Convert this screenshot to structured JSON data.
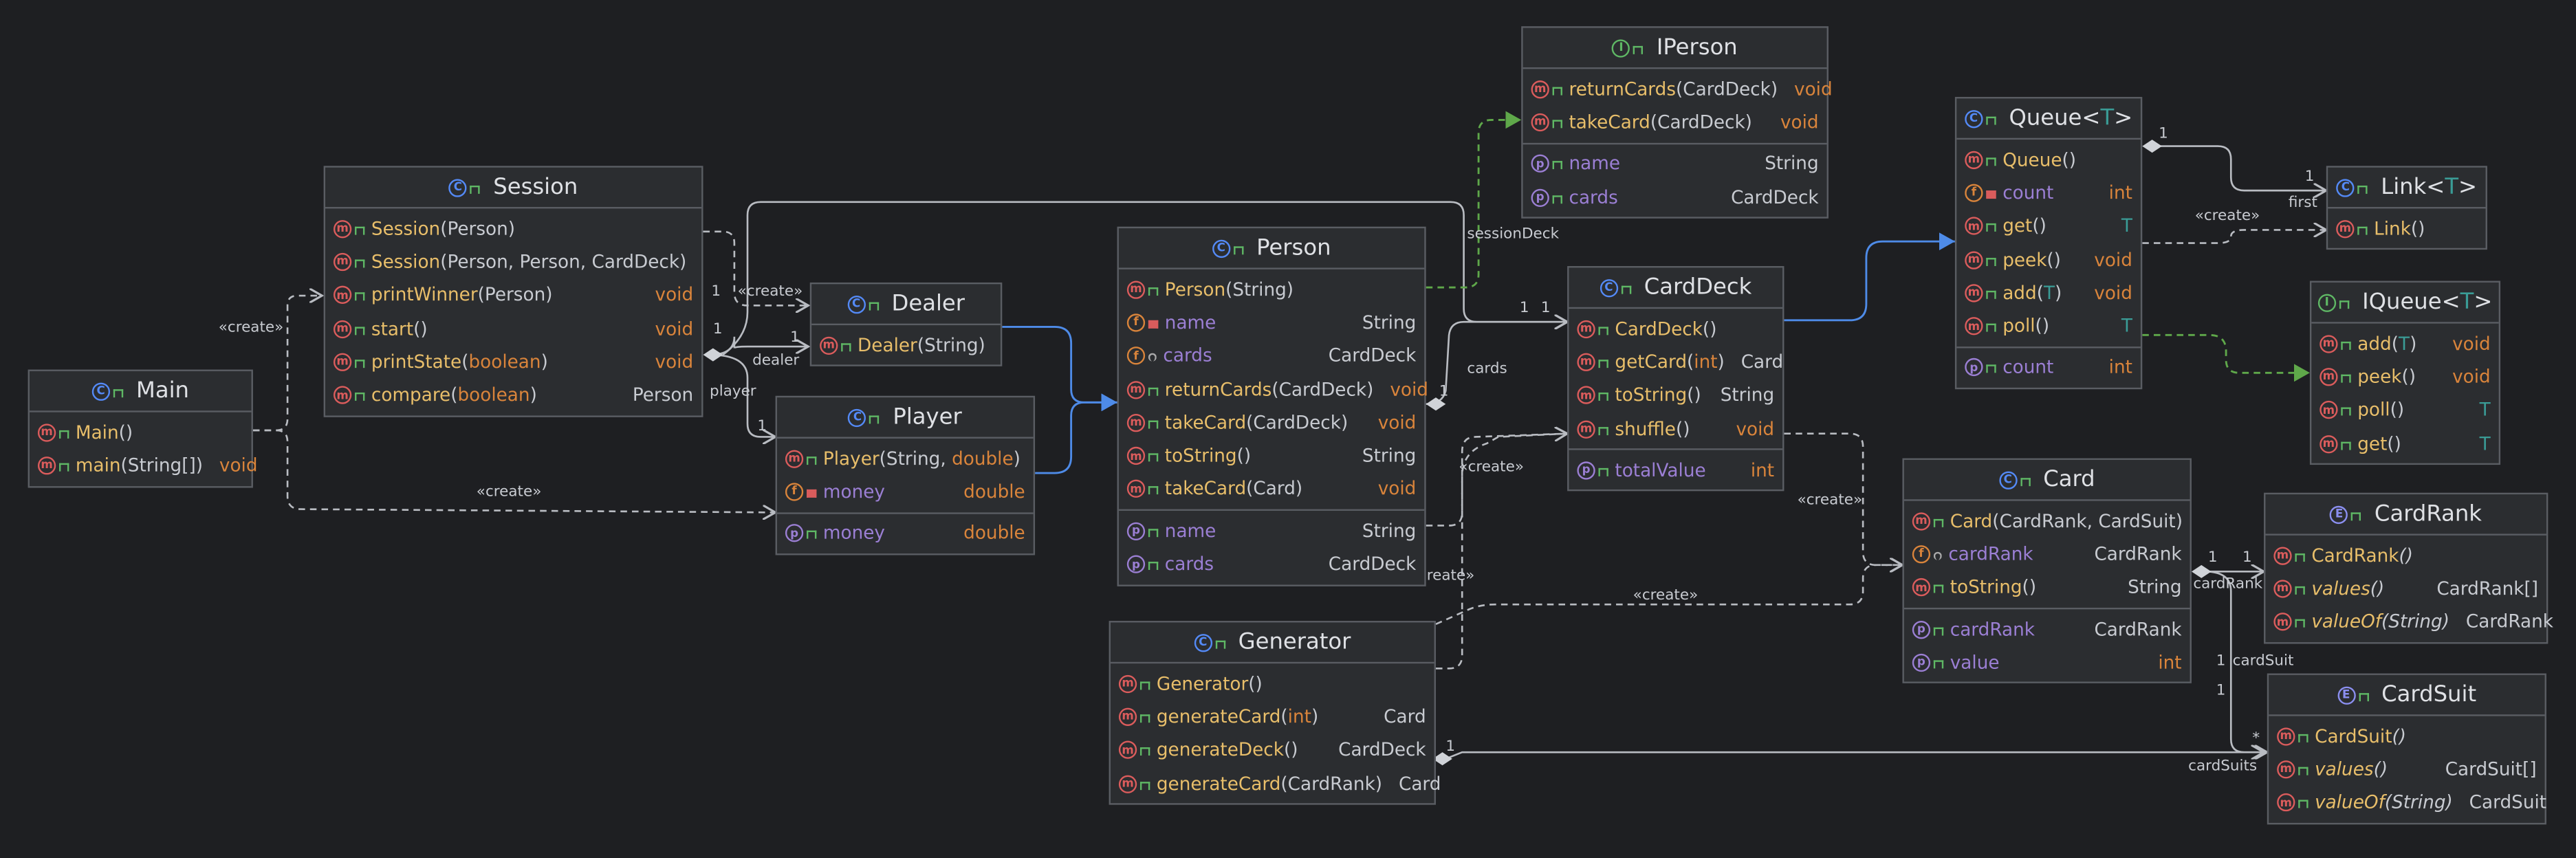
{
  "classes": {
    "main": {
      "name": "Main",
      "kind": "class",
      "members": [
        {
          "kind": "m",
          "name": "Main",
          "params": "()",
          "type": ""
        },
        {
          "kind": "m",
          "name": "main",
          "params": "(String[])",
          "type": "void"
        }
      ]
    },
    "session": {
      "name": "Session",
      "kind": "class",
      "members": [
        {
          "kind": "m",
          "name": "Session",
          "params": "(Person)",
          "type": ""
        },
        {
          "kind": "m",
          "name": "Session",
          "params": "(Person, Person, CardDeck)",
          "type": ""
        },
        {
          "kind": "m",
          "name": "printWinner",
          "params": "(Person)",
          "type": "void"
        },
        {
          "kind": "m",
          "name": "start",
          "params": "()",
          "type": "void"
        },
        {
          "kind": "m",
          "name": "printState",
          "params": "(boolean)",
          "type": "void"
        },
        {
          "kind": "m",
          "name": "compare",
          "params": "(boolean)",
          "type": "Person"
        }
      ]
    },
    "dealer": {
      "name": "Dealer",
      "kind": "class",
      "members": [
        {
          "kind": "m",
          "name": "Dealer",
          "params": "(String)",
          "type": ""
        }
      ]
    },
    "player": {
      "name": "Player",
      "kind": "class",
      "members": [
        {
          "kind": "m",
          "name": "Player",
          "params": "(String, double)",
          "type": ""
        },
        {
          "kind": "f",
          "name": "money",
          "params": "",
          "type": "double"
        },
        {
          "kind": "p",
          "name": "money",
          "params": "",
          "type": "double"
        }
      ]
    },
    "person": {
      "name": "Person",
      "kind": "class",
      "members": [
        {
          "kind": "m",
          "name": "Person",
          "params": "(String)",
          "type": ""
        },
        {
          "kind": "f",
          "name": "name",
          "params": "",
          "type": "String"
        },
        {
          "kind": "f",
          "name": "cards",
          "params": "",
          "type": "CardDeck"
        },
        {
          "kind": "m",
          "name": "returnCards",
          "params": "(CardDeck)",
          "type": "void"
        },
        {
          "kind": "m",
          "name": "takeCard",
          "params": "(CardDeck)",
          "type": "void"
        },
        {
          "kind": "m",
          "name": "toString",
          "params": "()",
          "type": "String"
        },
        {
          "kind": "m",
          "name": "takeCard",
          "params": "(Card)",
          "type": "void"
        },
        {
          "kind": "p",
          "name": "name",
          "params": "",
          "type": "String"
        },
        {
          "kind": "p",
          "name": "cards",
          "params": "",
          "type": "CardDeck"
        }
      ]
    },
    "iperson": {
      "name": "IPerson",
      "kind": "interface",
      "members": [
        {
          "kind": "m",
          "name": "returnCards",
          "params": "(CardDeck)",
          "type": "void"
        },
        {
          "kind": "m",
          "name": "takeCard",
          "params": "(CardDeck)",
          "type": "void"
        },
        {
          "kind": "p",
          "name": "name",
          "params": "",
          "type": "String"
        },
        {
          "kind": "p",
          "name": "cards",
          "params": "",
          "type": "CardDeck"
        }
      ]
    },
    "carddeck": {
      "name": "CardDeck",
      "kind": "class",
      "members": [
        {
          "kind": "m",
          "name": "CardDeck",
          "params": "()",
          "type": ""
        },
        {
          "kind": "m",
          "name": "getCard",
          "params": "(int)",
          "type": "Card"
        },
        {
          "kind": "m",
          "name": "toString",
          "params": "()",
          "type": "String"
        },
        {
          "kind": "m",
          "name": "shuffle",
          "params": "()",
          "type": "void"
        },
        {
          "kind": "p",
          "name": "totalValue",
          "params": "",
          "type": "int"
        }
      ]
    },
    "generator": {
      "name": "Generator",
      "kind": "class",
      "members": [
        {
          "kind": "m",
          "name": "Generator",
          "params": "()",
          "type": ""
        },
        {
          "kind": "m",
          "name": "generateCard",
          "params": "(int)",
          "type": "Card"
        },
        {
          "kind": "m",
          "name": "generateDeck",
          "params": "()",
          "type": "CardDeck"
        },
        {
          "kind": "m",
          "name": "generateCard",
          "params": "(CardRank)",
          "type": "Card"
        }
      ]
    },
    "queue": {
      "name": "Queue",
      "generic": "T",
      "kind": "class",
      "members": [
        {
          "kind": "m",
          "name": "Queue",
          "params": "()",
          "type": ""
        },
        {
          "kind": "f",
          "name": "count",
          "params": "",
          "type": "int"
        },
        {
          "kind": "m",
          "name": "get",
          "params": "()",
          "type": "T"
        },
        {
          "kind": "m",
          "name": "peek",
          "params": "()",
          "type": "void"
        },
        {
          "kind": "m",
          "name": "add",
          "params": "(T)",
          "type": "void"
        },
        {
          "kind": "m",
          "name": "poll",
          "params": "()",
          "type": "T"
        },
        {
          "kind": "p",
          "name": "count",
          "params": "",
          "type": "int"
        }
      ]
    },
    "link": {
      "name": "Link",
      "generic": "T",
      "kind": "class",
      "members": [
        {
          "kind": "m",
          "name": "Link",
          "params": "()",
          "type": ""
        }
      ]
    },
    "iqueue": {
      "name": "IQueue",
      "generic": "T",
      "kind": "interface",
      "members": [
        {
          "kind": "m",
          "name": "add",
          "params": "(T)",
          "type": "void"
        },
        {
          "kind": "m",
          "name": "peek",
          "params": "()",
          "type": "void"
        },
        {
          "kind": "m",
          "name": "poll",
          "params": "()",
          "type": "T"
        },
        {
          "kind": "m",
          "name": "get",
          "params": "()",
          "type": "T"
        }
      ]
    },
    "card": {
      "name": "Card",
      "kind": "class",
      "members": [
        {
          "kind": "m",
          "name": "Card",
          "params": "(CardRank, CardSuit)",
          "type": ""
        },
        {
          "kind": "f",
          "name": "cardRank",
          "params": "",
          "type": "CardRank"
        },
        {
          "kind": "m",
          "name": "toString",
          "params": "()",
          "type": "String"
        },
        {
          "kind": "p",
          "name": "cardRank",
          "params": "",
          "type": "CardRank"
        },
        {
          "kind": "p",
          "name": "value",
          "params": "",
          "type": "int"
        }
      ]
    },
    "cardrank": {
      "name": "CardRank",
      "kind": "enum",
      "members": [
        {
          "kind": "m",
          "name": "CardRank",
          "params": "()",
          "type": ""
        },
        {
          "kind": "m",
          "name": "values",
          "params": "()",
          "type": "CardRank[]"
        },
        {
          "kind": "m",
          "name": "valueOf",
          "params": "(String)",
          "type": "CardRank"
        }
      ]
    },
    "cardsuit": {
      "name": "CardSuit",
      "kind": "enum",
      "members": [
        {
          "kind": "m",
          "name": "CardSuit",
          "params": "()",
          "type": ""
        },
        {
          "kind": "m",
          "name": "values",
          "params": "()",
          "type": "CardSuit[]"
        },
        {
          "kind": "m",
          "name": "valueOf",
          "params": "(String)",
          "type": "CardSuit"
        }
      ]
    }
  },
  "edge_labels": {
    "create": "«create»",
    "one": "1",
    "many": "*",
    "player": "player",
    "dealer": "dealer",
    "sessionDeck": "sessionDeck",
    "cards": "cards",
    "first": "first",
    "cardRank": "cardRank",
    "cardSuit": "cardSuit",
    "cardSuits": "cardSuits"
  }
}
